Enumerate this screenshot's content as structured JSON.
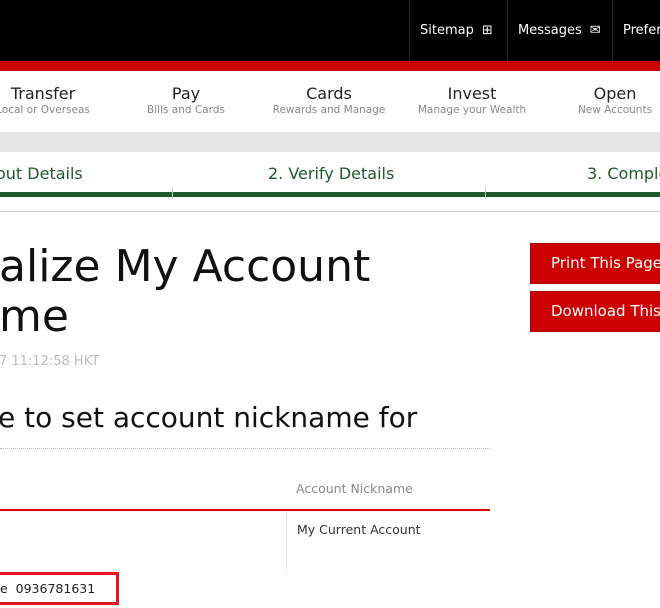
{
  "topbar": {
    "sitemap": "Sitemap",
    "messages": "Messages",
    "preferences": "Prefere"
  },
  "nav": [
    {
      "main": "Transfer",
      "sub": "Local or Overseas"
    },
    {
      "main": "Pay",
      "sub": "Bills and Cards"
    },
    {
      "main": "Cards",
      "sub": "Rewards and Manage"
    },
    {
      "main": "Invest",
      "sub": "Manage your Wealth"
    },
    {
      "main": "Open",
      "sub": "New Accounts"
    }
  ],
  "steps": [
    "out Details",
    "2. Verify Details",
    "3. Comple"
  ],
  "page": {
    "title_line1": "alize My Account",
    "title_line2": "me",
    "timestamp": "7 11:12:58 HKT",
    "subheading": "e to set account nickname for"
  },
  "table": {
    "header_nickname": "Account Nickname",
    "nickname_value": "My Current Account"
  },
  "highlight": {
    "label": "e",
    "number": "0936781631"
  },
  "buttons": {
    "print": "Print This Page",
    "download": "Download This"
  }
}
